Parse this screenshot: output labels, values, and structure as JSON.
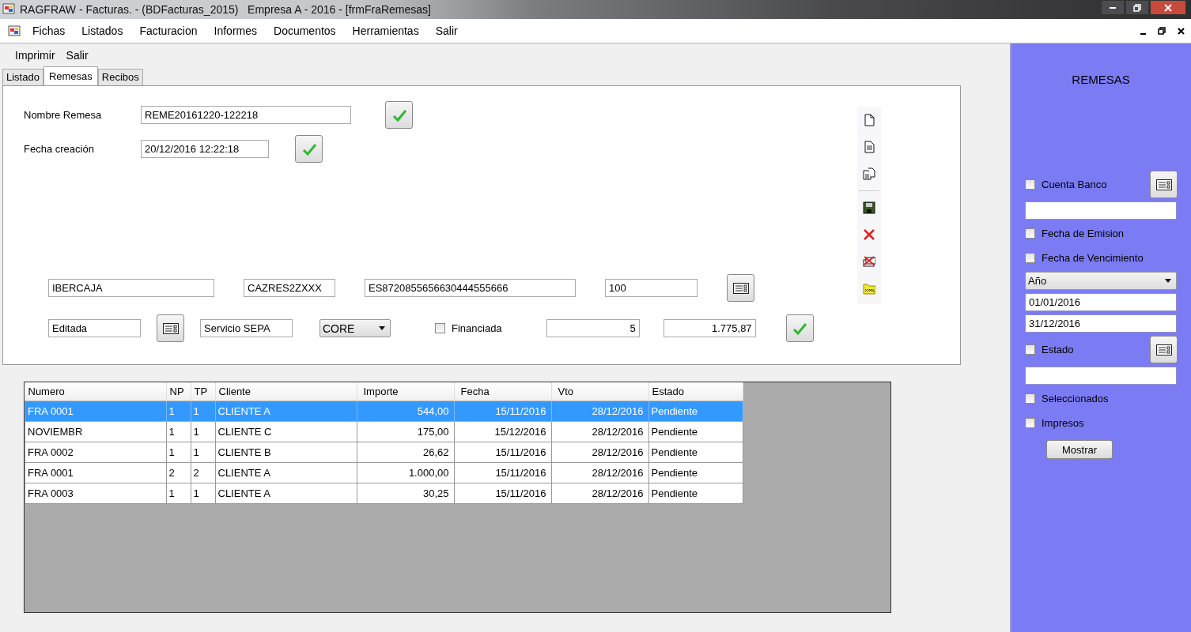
{
  "window": {
    "title": "RAGFRAW - Facturas. - (BDFacturas_2015)   Empresa A - 2016 - [frmFraRemesas]"
  },
  "menu": [
    "Fichas",
    "Listados",
    "Facturacion",
    "Informes",
    "Documentos",
    "Herramientas",
    "Salir"
  ],
  "toolbar": [
    "Imprimir",
    "Salir"
  ],
  "tabs": [
    {
      "label": "Listado",
      "selected": false
    },
    {
      "label": "Remesas",
      "selected": true
    },
    {
      "label": "Recibos",
      "selected": false
    }
  ],
  "form": {
    "nombre_remesa": {
      "label": "Nombre Remesa",
      "value": "REME20161220-122218"
    },
    "fecha_creacion": {
      "label": "Fecha creación",
      "value": "20/12/2016 12:22:18"
    },
    "bank_row": [
      "IBERCAJA",
      "CAZRES2ZXXX",
      "ES8720855656630444555666",
      "100"
    ],
    "estado": "Editada",
    "servicio": "Servicio SEPA",
    "esquema": "CORE",
    "financiada": {
      "label": "Financiada",
      "checked": false
    },
    "num_recibos": "5",
    "total": "1.775,87"
  },
  "table": {
    "columns": [
      "Numero",
      "NP",
      "TP",
      "Cliente",
      "Importe",
      "Fecha",
      "Vto",
      "Estado"
    ],
    "rows": [
      {
        "cells": [
          "FRA 0001",
          "1",
          "1",
          "CLIENTE A",
          "544,00",
          "15/11/2016",
          "28/12/2016",
          "Pendiente"
        ],
        "selected": true
      },
      {
        "cells": [
          "NOVIEMBR",
          "1",
          "1",
          "CLIENTE C",
          "175,00",
          "15/12/2016",
          "28/12/2016",
          "Pendiente"
        ],
        "selected": false
      },
      {
        "cells": [
          "FRA 0002",
          "1",
          "1",
          "CLIENTE B",
          "26,62",
          "15/11/2016",
          "28/12/2016",
          "Pendiente"
        ],
        "selected": false
      },
      {
        "cells": [
          "FRA 0001",
          "2",
          "2",
          "CLIENTE A",
          "1.000,00",
          "15/11/2016",
          "28/12/2016",
          "Pendiente"
        ],
        "selected": false
      },
      {
        "cells": [
          "FRA 0003",
          "1",
          "1",
          "CLIENTE A",
          "30,25",
          "15/11/2016",
          "28/12/2016",
          "Pendiente"
        ],
        "selected": false
      }
    ]
  },
  "sidebar": {
    "title": "REMESAS",
    "items": [
      {
        "kind": "checkbox",
        "label": "Cuenta Banco",
        "checked": false,
        "picker": true
      },
      {
        "kind": "field"
      },
      {
        "kind": "checkbox",
        "label": "Fecha de Emision",
        "checked": false,
        "picker": false
      },
      {
        "kind": "checkbox",
        "label": "Fecha de Vencimiento",
        "checked": false,
        "picker": false
      },
      {
        "kind": "select",
        "value": "Año"
      },
      {
        "kind": "field",
        "value": "01/01/2016"
      },
      {
        "kind": "field",
        "value": "31/12/2016"
      },
      {
        "kind": "checkbox",
        "label": "Estado",
        "checked": false,
        "picker": true
      },
      {
        "kind": "field"
      },
      {
        "kind": "checkbox",
        "label": "Seleccionados",
        "checked": false,
        "picker": false
      },
      {
        "kind": "checkbox",
        "label": "Impresos",
        "checked": false,
        "picker": false
      },
      {
        "kind": "button",
        "label": "Mostrar"
      }
    ]
  }
}
